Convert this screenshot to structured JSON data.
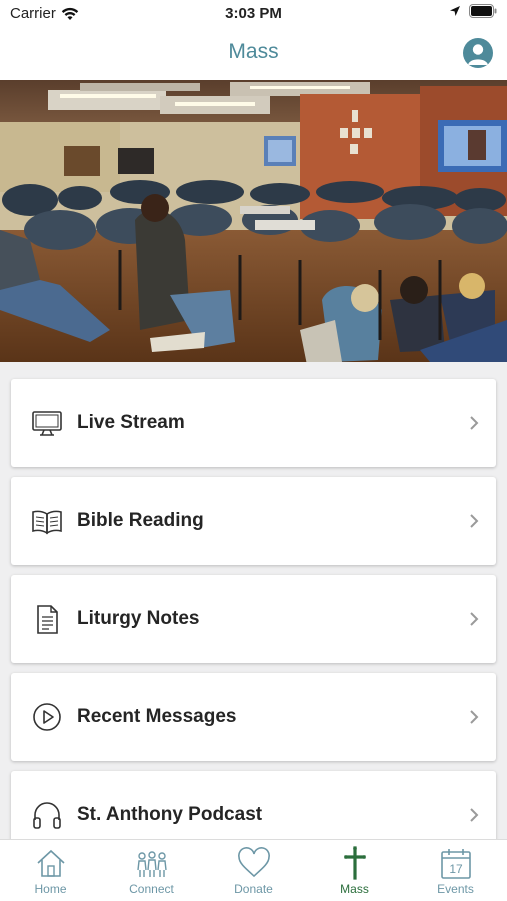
{
  "status": {
    "carrier": "Carrier",
    "time": "3:03 PM"
  },
  "header": {
    "title": "Mass"
  },
  "menu": {
    "items": [
      {
        "label": "Live Stream",
        "icon": "monitor-icon"
      },
      {
        "label": "Bible Reading",
        "icon": "book-icon"
      },
      {
        "label": "Liturgy Notes",
        "icon": "document-icon"
      },
      {
        "label": "Recent Messages",
        "icon": "play-circle-icon"
      },
      {
        "label": "St. Anthony Podcast",
        "icon": "headphones-icon"
      }
    ]
  },
  "tabs": [
    {
      "label": "Home",
      "icon": "home-icon",
      "active": false
    },
    {
      "label": "Connect",
      "icon": "people-icon",
      "active": false
    },
    {
      "label": "Donate",
      "icon": "heart-icon",
      "active": false
    },
    {
      "label": "Mass",
      "icon": "cross-icon",
      "active": true
    },
    {
      "label": "Events",
      "icon": "calendar-icon",
      "active": false
    }
  ],
  "events_calendar_day": "17",
  "colors": {
    "accent": "#4e8a9a",
    "tab_inactive": "#6d97a6",
    "tab_active": "#2b6e3c",
    "background": "#efeff0"
  }
}
